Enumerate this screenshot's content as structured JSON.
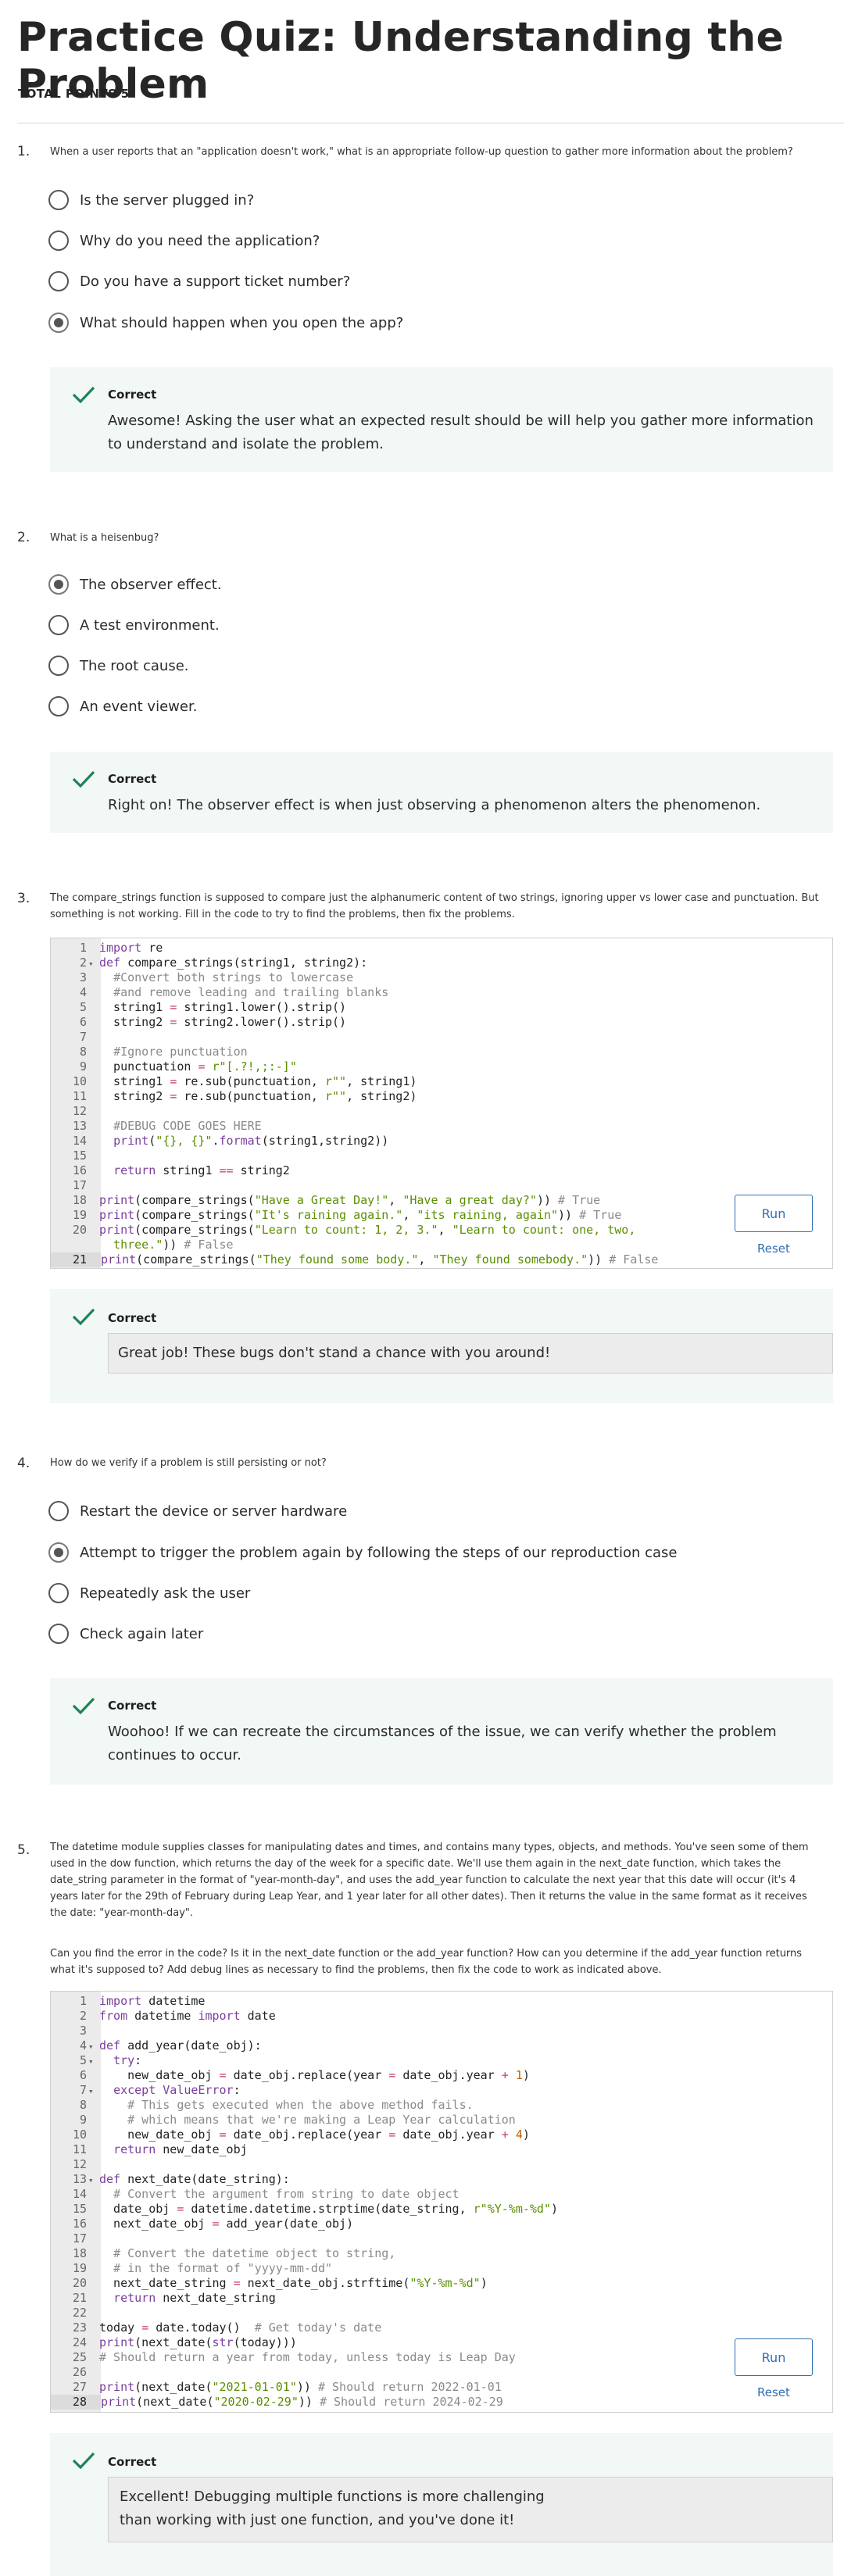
{
  "page_title": "Practice Quiz: Understanding the Problem",
  "total_points": "TOTAL POINTS 5",
  "questions": [
    {
      "number": "1.",
      "text": "When a user reports that an \"application doesn't work,\" what is an appropriate follow-up question to gather more information about the problem?",
      "options": [
        "Is the server plugged in?",
        "Why do you need the application?",
        "Do you have a support ticket number?",
        "What should happen when you open the app?"
      ],
      "selected": 3,
      "feedback_title": "Correct",
      "feedback_text": "Awesome! Asking the user what an expected result should be will help you gather more information to understand and isolate the problem."
    },
    {
      "number": "2.",
      "text": "What is a heisenbug?",
      "options": [
        "The observer effect.",
        "A test environment.",
        "The root cause.",
        "An event viewer."
      ],
      "selected": 0,
      "feedback_title": "Correct",
      "feedback_text": "Right on! The observer effect is when just observing a phenomenon alters the phenomenon."
    },
    {
      "number": "3.",
      "text": "The compare_strings function is supposed to compare just the alphanumeric content of two strings, ignoring upper vs lower case and punctuation. But something is not working. Fill in the code to try to find the problems, then fix the problems.",
      "code": [
        "import re",
        "def compare_strings(string1, string2):",
        "  #Convert both strings to lowercase",
        "  #and remove leading and trailing blanks",
        "  string1 = string1.lower().strip()",
        "  string2 = string2.lower().strip()",
        "",
        "  #Ignore punctuation",
        "  punctuation = r\"[.?!,;:-]\"",
        "  string1 = re.sub(punctuation, r\"\", string1)",
        "  string2 = re.sub(punctuation, r\"\", string2)",
        "",
        "  #DEBUG CODE GOES HERE",
        "  print(\"{}, {}\".format(string1,string2))",
        "",
        "  return string1 == string2",
        "",
        "print(compare_strings(\"Have a Great Day!\", \"Have a great day?\")) # True",
        "print(compare_strings(\"It's raining again.\", \"its raining, again\")) # True",
        "print(compare_strings(\"Learn to count: 1, 2, 3.\", \"Learn to count: one, two,",
        "print(compare_strings(\"They found some body.\", \"They found somebody.\")) # False"
      ],
      "run_label": "Run",
      "reset_label": "Reset",
      "feedback_title": "Correct",
      "feedback_text": "Great job! These bugs don't stand a chance with you around!"
    },
    {
      "number": "4.",
      "text": "How do we verify if a problem is still persisting or not?",
      "options": [
        "Restart the device or server hardware",
        "Attempt to trigger the problem again by following the steps of our reproduction case",
        "Repeatedly ask the user",
        "Check again later"
      ],
      "selected": 1,
      "feedback_title": "Correct",
      "feedback_text": "Woohoo! If we can recreate the circumstances of the issue, we can verify whether the problem continues to occur."
    },
    {
      "number": "5.",
      "text": "The datetime module supplies classes for manipulating dates and times, and contains many types, objects, and methods. You've seen some of them used in the dow function, which returns the day of the week for a specific date. We'll use them again in the next_date function, which takes the date_string parameter in the format of \"year-month-day\", and uses the add_year function to calculate the next year that this date will occur (it's 4 years later for the 29th of February during Leap Year, and 1 year later for all other dates). Then it returns the value in the same format as it receives the date: \"year-month-day\".",
      "text2": "Can you find the error in the code? Is it in the next_date function or the add_year function? How can you determine if the add_year function returns what it's supposed to? Add debug lines as necessary to find the problems, then fix the code to work as indicated above.",
      "run_label": "Run",
      "reset_label": "Reset",
      "feedback_title": "Correct",
      "feedback_text": "Excellent! Debugging multiple functions is more challenging than working with just one function, and you've done it!"
    }
  ]
}
